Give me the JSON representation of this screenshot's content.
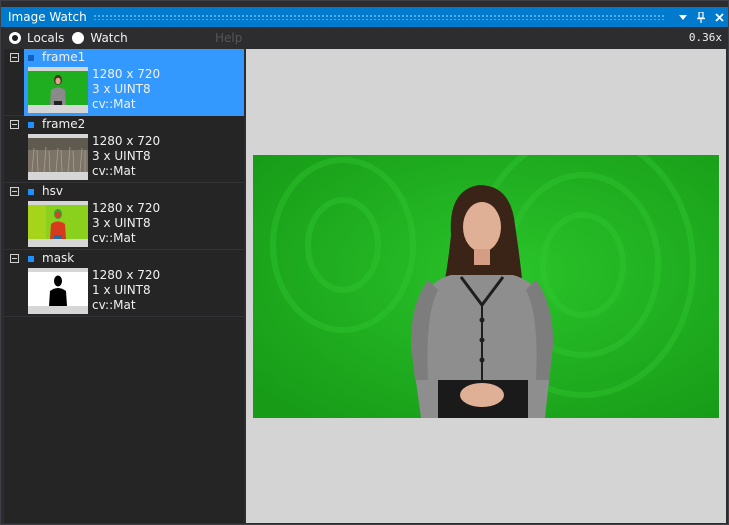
{
  "window": {
    "title": "Image Watch"
  },
  "titlebar": {
    "dropdown_icon": "chevron-down-icon",
    "pin_icon": "pin-icon",
    "close_icon": "close-icon"
  },
  "toolbar": {
    "locals_label": "Locals",
    "watch_label": "Watch",
    "help_label": "Help",
    "zoom_label": "0.36x",
    "selected_radio": "Locals"
  },
  "items": [
    {
      "name": "frame1",
      "size": "1280 x 720",
      "type": "3 x UINT8",
      "class": "cv::Mat",
      "selected": true
    },
    {
      "name": "frame2",
      "size": "1280 x 720",
      "type": "3 x UINT8",
      "class": "cv::Mat",
      "selected": false
    },
    {
      "name": "hsv",
      "size": "1280 x 720",
      "type": "3 x UINT8",
      "class": "cv::Mat",
      "selected": false
    },
    {
      "name": "mask",
      "size": "1280 x 720",
      "type": "1 x UINT8",
      "class": "cv::Mat",
      "selected": false
    }
  ],
  "colors": {
    "accent": "#007acc",
    "selection": "#3399ff",
    "panel_bg": "#252526",
    "viewer_bg": "#d4d4d4",
    "green_screen": "#20b820"
  }
}
